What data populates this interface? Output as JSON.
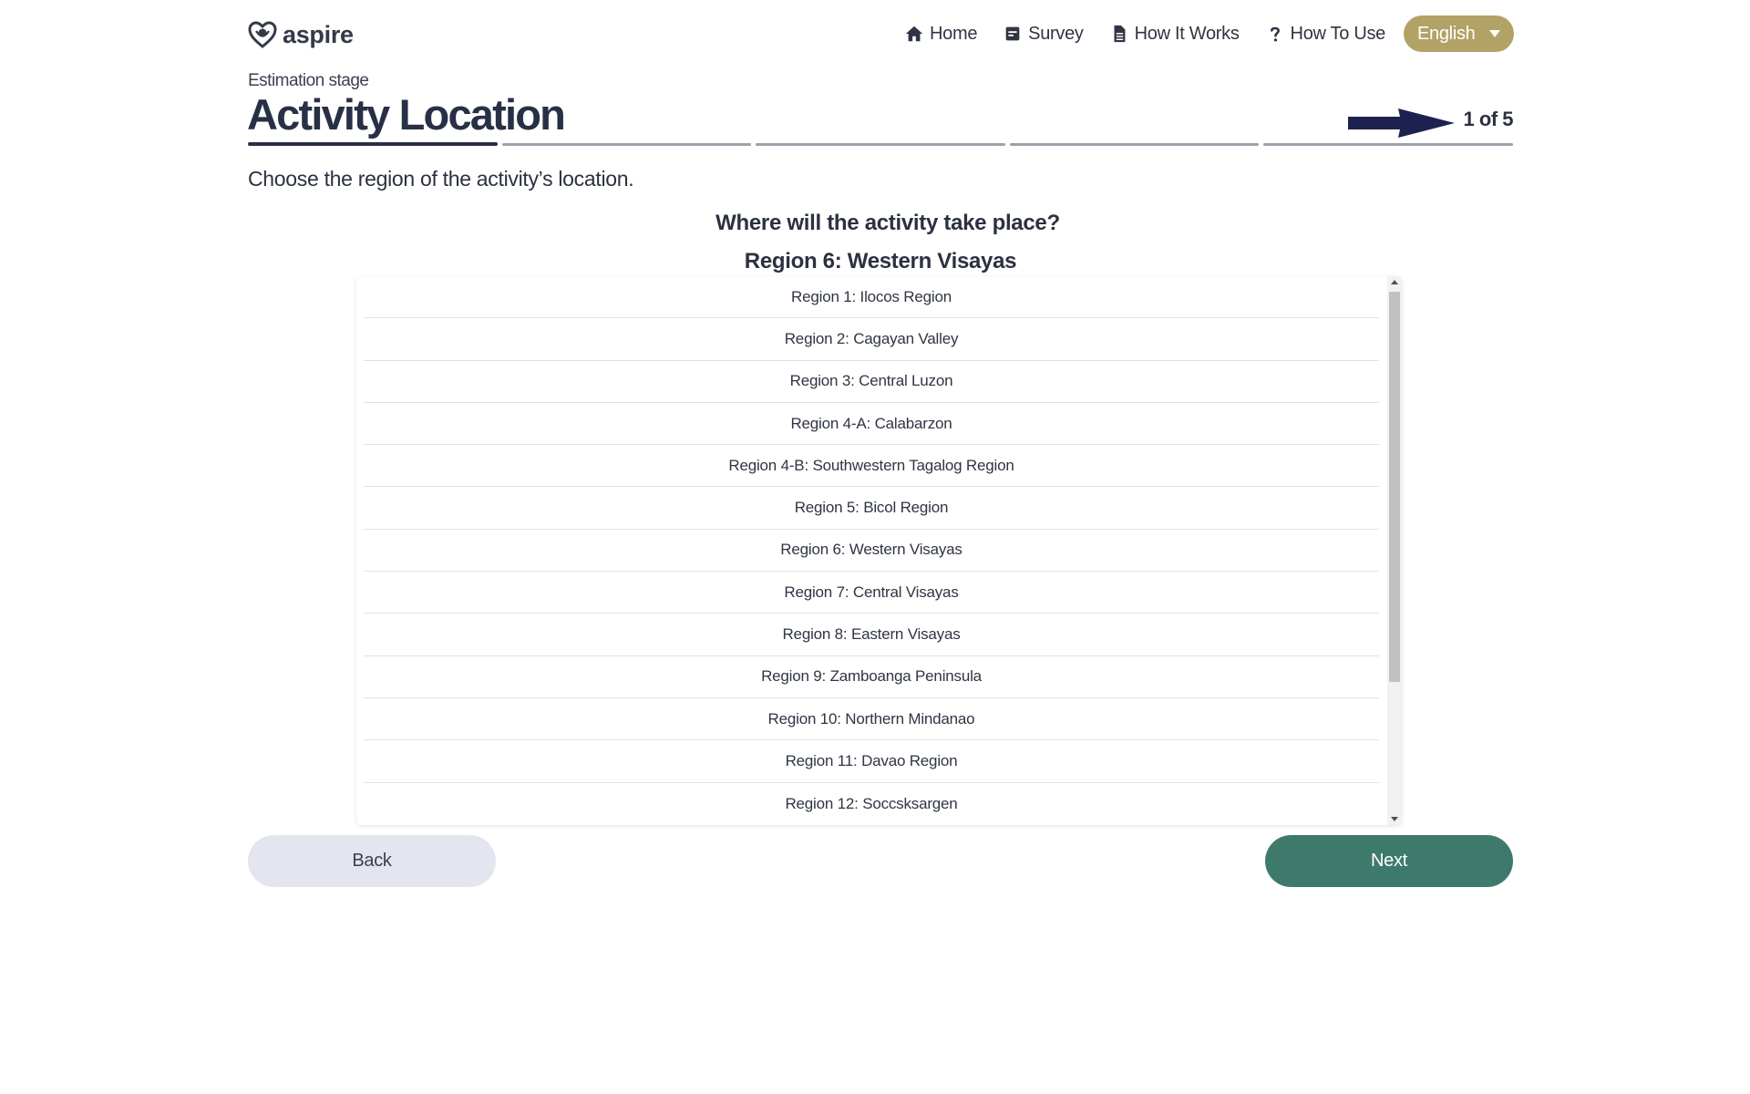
{
  "header": {
    "logo_text": "aspire",
    "nav": [
      {
        "label": "Home",
        "icon": "home-icon"
      },
      {
        "label": "Survey",
        "icon": "survey-icon"
      },
      {
        "label": "How It Works",
        "icon": "document-icon"
      },
      {
        "label": "How To Use",
        "icon": "question-icon"
      }
    ],
    "language": "English"
  },
  "page": {
    "stage_label": "Estimation stage",
    "title": "Activity Location",
    "progress_label": "1 of 5",
    "progress": {
      "current": 1,
      "total": 5
    },
    "instruction": "Choose the region of the activity’s location.",
    "question": "Where will the activity take place?",
    "selected_value": "Region 6: Western Visayas"
  },
  "regions": [
    "Region 1: Ilocos Region",
    "Region 2: Cagayan Valley",
    "Region 3: Central Luzon",
    "Region 4-A: Calabarzon",
    "Region 4-B: Southwestern Tagalog Region",
    "Region 5: Bicol Region",
    "Region 6: Western Visayas",
    "Region 7: Central Visayas",
    "Region 8: Eastern Visayas",
    "Region 9: Zamboanga Peninsula",
    "Region 10: Northern Mindanao",
    "Region 11: Davao Region",
    "Region 12: Soccsksargen"
  ],
  "buttons": {
    "back": "Back",
    "next": "Next"
  },
  "colors": {
    "language_button": "#b3a266",
    "next_button": "#3e7a6c",
    "back_button": "#e3e6ef",
    "title_text": "#283046",
    "arrow": "#1c2150"
  }
}
